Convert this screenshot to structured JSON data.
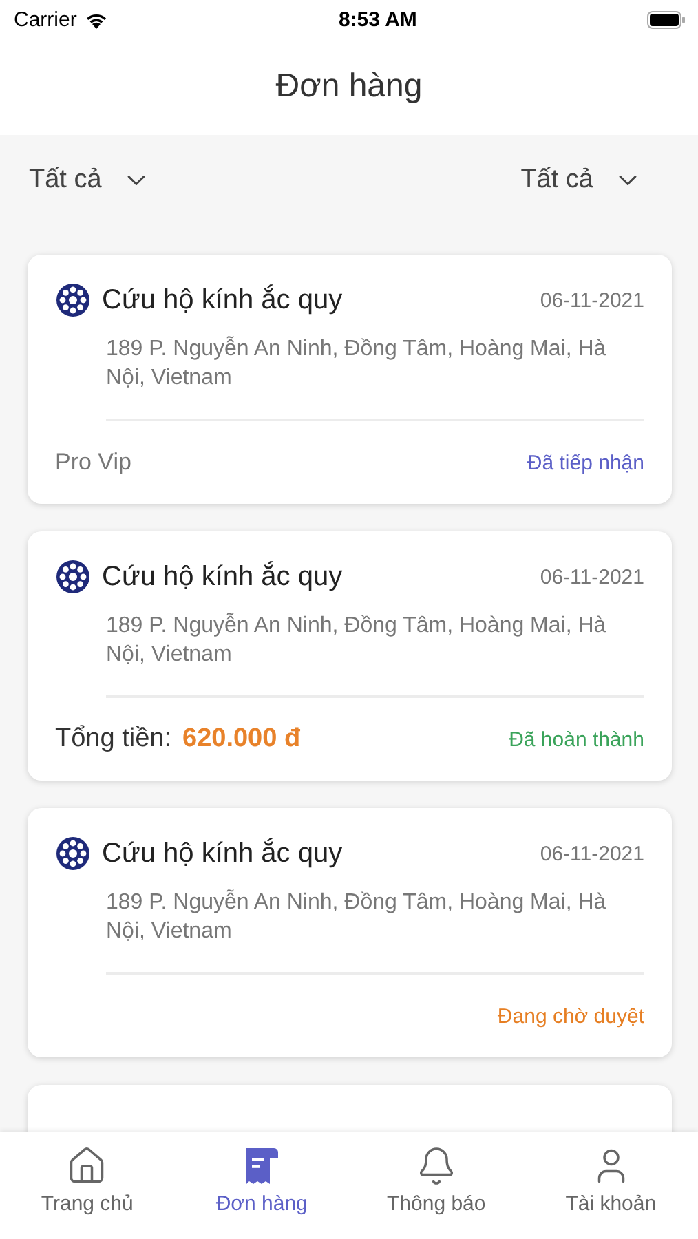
{
  "status_bar": {
    "carrier": "Carrier",
    "time": "8:53 AM"
  },
  "header": {
    "title": "Đơn hàng"
  },
  "filters": [
    {
      "label": "Tất cả"
    },
    {
      "label": "Tất cả"
    }
  ],
  "orders": [
    {
      "title": "Cứu hộ kính ắc quy",
      "date": "06-11-2021",
      "address": "189 P. Nguyễn An Ninh, Đồng Tâm, Hoàng Mai, Hà Nội, Vietnam",
      "footer": {
        "kind": "plan",
        "text": "Pro Vip"
      },
      "status": {
        "kind": "received",
        "text": "Đã tiếp nhận"
      }
    },
    {
      "title": "Cứu hộ kính ắc quy",
      "date": "06-11-2021",
      "address": "189 P. Nguyễn An Ninh, Đồng Tâm, Hoàng Mai, Hà Nội, Vietnam",
      "footer": {
        "kind": "total",
        "label": "Tổng tiền:",
        "amount": "620.000 đ"
      },
      "status": {
        "kind": "completed",
        "text": "Đã hoàn thành"
      }
    },
    {
      "title": "Cứu hộ kính ắc quy",
      "date": "06-11-2021",
      "address": "189 P. Nguyễn An Ninh, Đồng Tâm, Hoàng Mai, Hà Nội, Vietnam",
      "status": {
        "kind": "pending",
        "text": "Đang chờ duyệt"
      }
    },
    {
      "kind": "cut_off"
    }
  ],
  "tab_bar": [
    {
      "label": "Trang chủ",
      "selected": false
    },
    {
      "label": "Đơn hàng",
      "selected": true
    },
    {
      "label": "Thông báo",
      "selected": false
    },
    {
      "label": "Tài khoản",
      "selected": false
    }
  ]
}
